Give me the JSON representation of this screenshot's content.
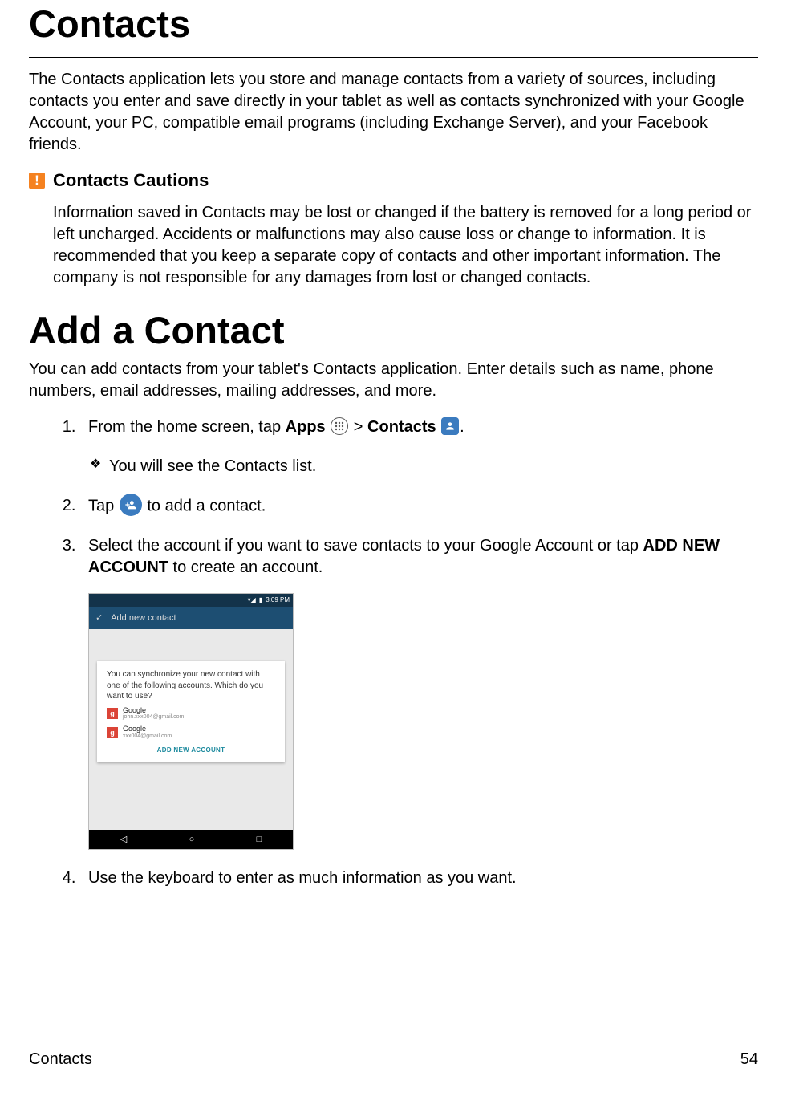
{
  "heading1": "Contacts",
  "intro": "The Contacts application lets you store and manage contacts from a variety of sources, including contacts you enter and save directly in your tablet as well as contacts synchronized with your Google Account, your PC, compatible email programs (including Exchange Server), and your Facebook friends.",
  "caution": {
    "icon_glyph": "!",
    "title": "Contacts Cautions",
    "body": "Information saved in Contacts may be lost or changed if the battery is removed for a long period or left uncharged. Accidents or malfunctions may also cause loss or change to information. It is recommended that you keep a separate copy of contacts and other important information. The company is not responsible for any damages from lost or changed contacts."
  },
  "heading2": "Add a Contact",
  "intro2": "You can add contacts from your tablet's Contacts application. Enter details such as name, phone numbers, email addresses, mailing addresses, and more.",
  "steps": {
    "s1": {
      "pre": "From the home screen, tap ",
      "apps_label": "Apps",
      "gt": " > ",
      "contacts_label": "Contacts",
      "post": ".",
      "sub": "You will see the Contacts list."
    },
    "s2": {
      "pre": "Tap ",
      "post": " to add a contact."
    },
    "s3": {
      "pre": "Select the account if you want to save contacts to your Google Account or tap ",
      "bold": "ADD NEW ACCOUNT",
      "post": " to create an account."
    },
    "s4": "Use the keyboard to enter as much information as you want."
  },
  "screenshot": {
    "status_time": "3:09 PM",
    "title_check": "✓",
    "title_text": "Add new contact",
    "dialog_prompt": "You can synchronize your new contact with one of the following accounts. Which do you want to use?",
    "accounts": [
      {
        "badge": "g",
        "name": "Google",
        "email": "john.xxx004@gmail.com"
      },
      {
        "badge": "g",
        "name": "Google",
        "email": "xxx004@gmail.com"
      }
    ],
    "add_new": "ADD NEW ACCOUNT",
    "nav": {
      "back": "◁",
      "home": "○",
      "recent": "□"
    }
  },
  "footer": {
    "section": "Contacts",
    "page": "54"
  }
}
